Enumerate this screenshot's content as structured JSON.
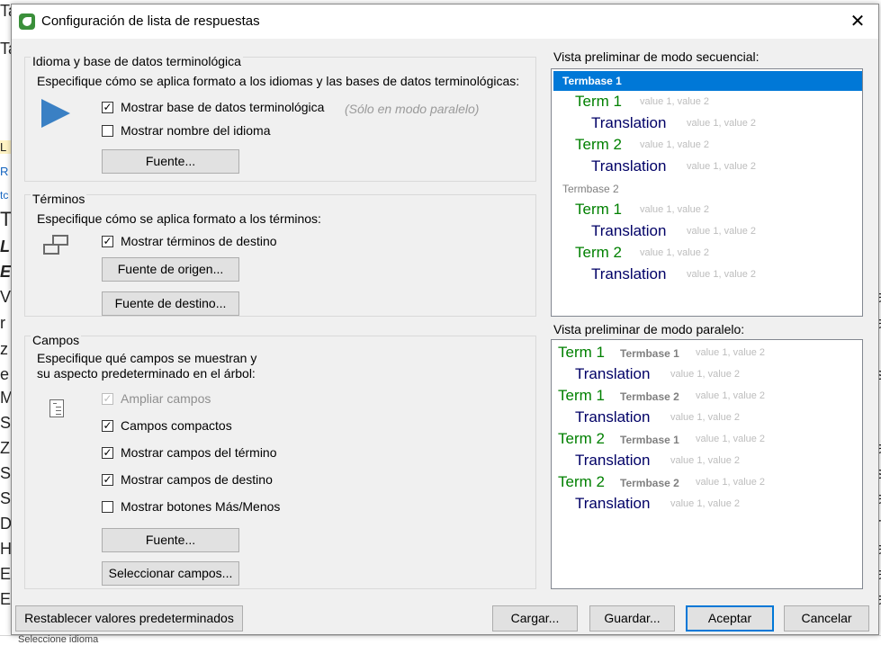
{
  "dialog": {
    "title": "Configuración de lista de respuestas",
    "close_glyph": "✕"
  },
  "background": {
    "left_fragments": [
      "Ta",
      "Ta",
      "L",
      "R",
      "tc",
      "T",
      "L",
      "E",
      "V",
      "r",
      "z",
      "e",
      "M",
      "S",
      "Z",
      "S",
      "S",
      "D",
      "H",
      "E",
      "E"
    ],
    "right_fragments": [
      "a",
      "a",
      ",",
      "s",
      "a",
      "s",
      "a",
      "r",
      "a",
      "a",
      "a"
    ],
    "bottom_text": "Seleccione idioma"
  },
  "language_group": {
    "title": "Idioma y base de datos terminológica",
    "description": "Especifique cómo se aplica formato a los idiomas y las bases de datos terminológicas:",
    "icon": "play-icon",
    "checkboxes": [
      {
        "label": "Mostrar base de datos terminológica",
        "checked": true
      },
      {
        "label": "Mostrar nombre del idioma",
        "checked": false
      }
    ],
    "hint": "(Sólo en modo paralelo)",
    "font_button": "Fuente..."
  },
  "terms_group": {
    "title": "Términos",
    "description": "Especifique cómo se aplica formato a los términos:",
    "icon": "terms-icon",
    "checkbox": {
      "label": "Mostrar términos de destino",
      "checked": true
    },
    "source_font_button": "Fuente de origen...",
    "target_font_button": "Fuente de destino..."
  },
  "fields_group": {
    "title": "Campos",
    "description_line1": "Especifique qué campos se muestran y",
    "description_line2": "su aspecto predeterminado en el árbol:",
    "icon": "fields-icon",
    "checkboxes": [
      {
        "label": "Ampliar campos",
        "checked": true,
        "disabled": true
      },
      {
        "label": "Campos compactos",
        "checked": true,
        "disabled": false
      },
      {
        "label": "Mostrar campos del término",
        "checked": true,
        "disabled": false
      },
      {
        "label": "Mostrar campos de destino",
        "checked": true,
        "disabled": false
      },
      {
        "label": "Mostrar botones Más/Menos",
        "checked": false,
        "disabled": false
      }
    ],
    "font_button": "Fuente...",
    "select_fields_button": "Seleccionar campos..."
  },
  "sequential_preview": {
    "label": "Vista preliminar de modo secuencial:",
    "termbase1": "Termbase 1",
    "termbase2": "Termbase 2",
    "term1": "Term 1",
    "term2": "Term 2",
    "translation": "Translation",
    "values": "value 1, value 2"
  },
  "parallel_preview": {
    "label": "Vista preliminar de modo paralelo:",
    "term1": "Term 1",
    "term2": "Term 2",
    "termbase1": "Termbase 1",
    "termbase2": "Termbase 2",
    "translation": "Translation",
    "values": "value 1, value 2"
  },
  "footer": {
    "reset_button": "Restablecer valores predeterminados",
    "load_button": "Cargar...",
    "save_button": "Guardar...",
    "accept_button": "Aceptar",
    "cancel_button": "Cancelar"
  },
  "colors": {
    "accent": "#0078d7",
    "term": "#008000",
    "translation": "#000066",
    "value": "#bdbdbd",
    "termbase": "#808080"
  }
}
